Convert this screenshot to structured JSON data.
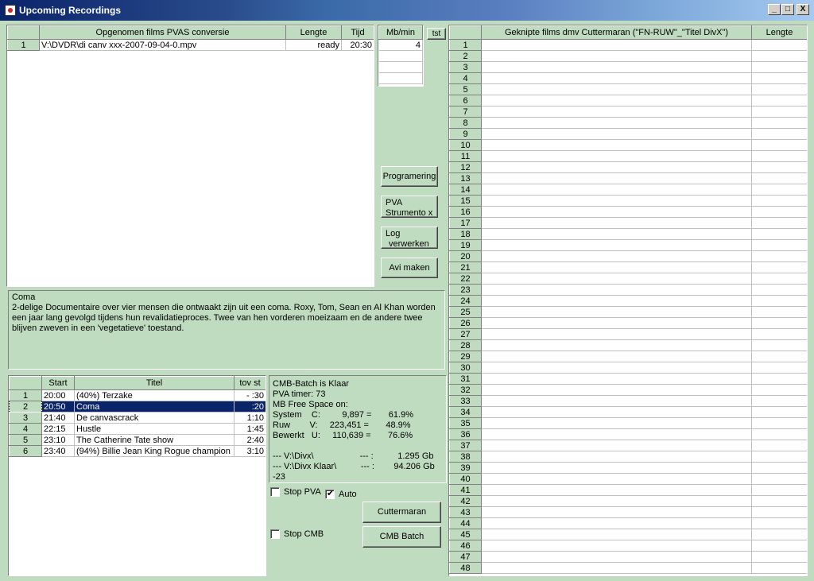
{
  "window": {
    "title": "Upcoming Recordings",
    "minimize": "_",
    "maximize": "□",
    "close": "X"
  },
  "recordings": {
    "headers": [
      "",
      "Opgenomen films PVAS conversie",
      "Lengte",
      "Tijd"
    ],
    "rows": [
      {
        "n": "1",
        "file": "V:\\DVDR\\di canv xxx-2007-09-04-0.mpv",
        "lengte": "ready",
        "tijd": "20:30"
      }
    ]
  },
  "mbmin": {
    "header": "Mb/min",
    "value": "4",
    "tst": "tst"
  },
  "buttons": {
    "programmering": "Programering",
    "pva_line1": "PVA",
    "pva_line2": "Strumento x",
    "log_line1": "Log",
    "log_line2": "verwerken",
    "avi": "Avi maken",
    "cuttermaran": "Cuttermaran",
    "cmb_batch": "CMB Batch"
  },
  "description": {
    "title": "Coma",
    "text": "2-delige Documentaire over vier mensen die ontwaakt zijn uit een coma. Roxy, Tom, Sean en Al Khan worden een jaar lang gevolgd tijdens hun revalidatieproces. Twee van hen vorderen moeizaam en de andere twee blijven zweven in een 'vegetatieve' toestand."
  },
  "schedule": {
    "headers": [
      "",
      "Start",
      "Titel",
      "tov st"
    ],
    "rows": [
      {
        "n": "1",
        "start": "20:00",
        "titel": "(40%) Terzake",
        "tov": "- :30"
      },
      {
        "n": "2",
        "start": "20:50",
        "titel": "Coma",
        "tov": ":20"
      },
      {
        "n": "3",
        "start": "21:40",
        "titel": "De canvascrack",
        "tov": "1:10"
      },
      {
        "n": "4",
        "start": "22:15",
        "titel": "Hustle",
        "tov": "1:45"
      },
      {
        "n": "5",
        "start": "23:10",
        "titel": "The Catherine Tate show",
        "tov": "2:40"
      },
      {
        "n": "6",
        "start": "23:40",
        "titel": "(94%) Billie Jean King Rogue champion",
        "tov": "3:10"
      }
    ],
    "selected_row": 2
  },
  "status": {
    "lines": [
      "CMB-Batch is Klaar",
      "PVA timer: 73",
      "MB Free Space on:",
      "System    C:         9,897 =       61.9%",
      "Ruw        V:     223,451 =       48.9%",
      "Bewerkt   U:     110,639 =       76.6%",
      "",
      "--- V:\\Divx\\                   --- :          1.295 Gb",
      "--- V:\\Divx Klaar\\          --- :        94.206 Gb",
      "-23"
    ]
  },
  "checkboxes": {
    "stop_pva": {
      "label": "Stop PVA",
      "checked": false
    },
    "auto": {
      "label": "Auto",
      "checked": true
    },
    "stop_cmb": {
      "label": "Stop CMB",
      "checked": false
    }
  },
  "cuts": {
    "headers": [
      "",
      "Geknipte films dmv Cuttermaran        (\"FN-RUW\"_\"Titel DivX\")",
      "Lengte"
    ],
    "row_count": 48
  }
}
